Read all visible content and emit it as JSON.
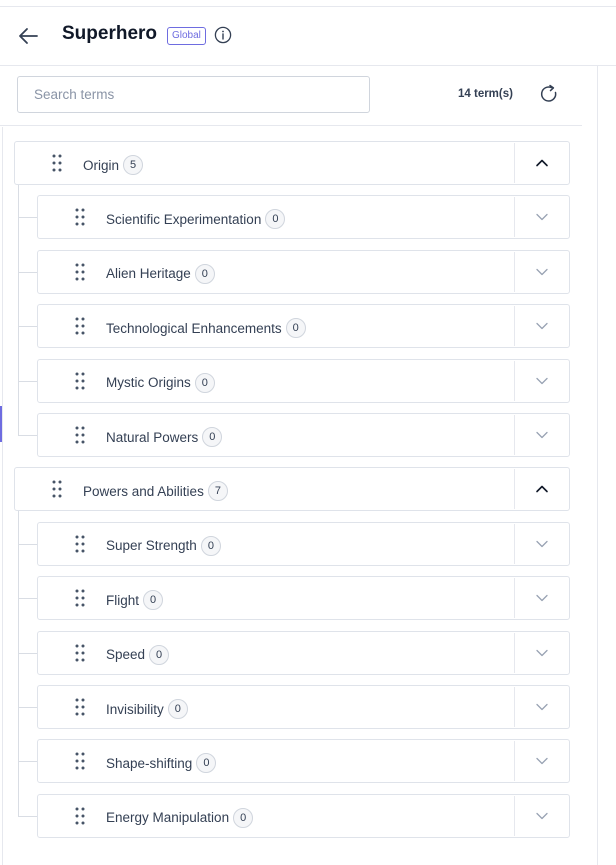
{
  "header": {
    "title": "Superhero",
    "badge": "Global"
  },
  "toolbar": {
    "search_placeholder": "Search terms",
    "search_value": "",
    "term_count": "14 term(s)"
  },
  "groups": [
    {
      "label": "Origin",
      "count": "5",
      "expanded": true,
      "children": [
        {
          "label": "Scientific Experimentation",
          "count": "0"
        },
        {
          "label": "Alien Heritage",
          "count": "0"
        },
        {
          "label": "Technological Enhancements",
          "count": "0"
        },
        {
          "label": "Mystic Origins",
          "count": "0"
        },
        {
          "label": "Natural Powers",
          "count": "0"
        }
      ]
    },
    {
      "label": "Powers and Abilities",
      "count": "7",
      "expanded": true,
      "children": [
        {
          "label": "Super Strength",
          "count": "0"
        },
        {
          "label": "Flight",
          "count": "0"
        },
        {
          "label": "Speed",
          "count": "0"
        },
        {
          "label": "Invisibility",
          "count": "0"
        },
        {
          "label": "Shape-shifting",
          "count": "0"
        },
        {
          "label": "Energy Manipulation",
          "count": "0"
        }
      ]
    }
  ],
  "colors": {
    "accent": "#6e6ce0",
    "border": "#dfe3ea",
    "text": "#344054"
  },
  "icons": {
    "back": "arrow-left-icon",
    "info": "info-icon",
    "refresh": "refresh-icon",
    "drag": "drag-handle-icon",
    "expanded": "chevron-up-icon",
    "collapsed": "chevron-down-icon"
  }
}
